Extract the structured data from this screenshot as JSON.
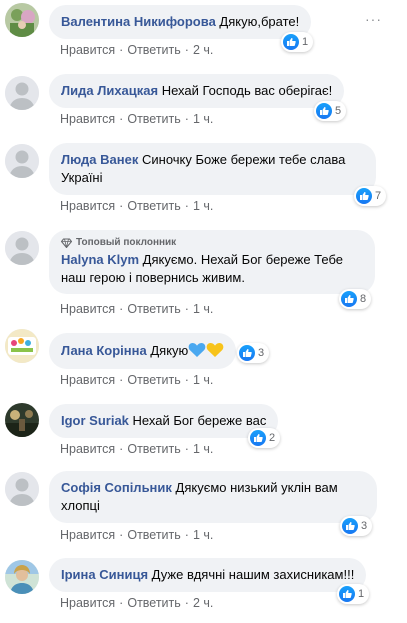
{
  "comments": [
    {
      "author": "Валентина Никифорова",
      "text": "Дякую,брате!",
      "actions": [
        "Нравится",
        "Ответить",
        "2 ч."
      ],
      "likes": "1"
    },
    {
      "author": "Лида Лихацкая",
      "text": "Нехай Господь вас оберігає!",
      "actions": [
        "Нравится",
        "Ответить",
        "1 ч."
      ],
      "likes": "5"
    },
    {
      "author": "Люда Ванек",
      "text_line1": "Синочку Боже бережи тебе слава",
      "text_line2": "Україні",
      "actions": [
        "Нравится",
        "Ответить",
        "1 ч."
      ],
      "likes": "7"
    },
    {
      "badge": "Топовый поклонник",
      "author": "Halyna Klym",
      "text_line1": "Дякуємо. Нехай Бог береже Тебе",
      "text_line2": "наш герою і повернись живим.",
      "actions": [
        "Нравится",
        "Ответить",
        "1 ч."
      ],
      "likes": "8"
    },
    {
      "author": "Лана Корінна",
      "text": "Дякую",
      "actions": [
        "Нравится",
        "Ответить",
        "1 ч."
      ],
      "likes": "3"
    },
    {
      "author": "Igor Suriak",
      "text": "Нехай Бог береже вас",
      "actions": [
        "Нравится",
        "Ответить",
        "1 ч."
      ],
      "likes": "2"
    },
    {
      "author": "Софія Сопільник",
      "text_line1": "Дякуємо низький уклін вам",
      "text_line2": "хлопці",
      "actions": [
        "Нравится",
        "Ответить",
        "1 ч."
      ],
      "likes": "3"
    },
    {
      "author": "Ірина Синиця",
      "text": "Дуже вдячні нашим захисникам!!!",
      "actions": [
        "Нравится",
        "Ответить",
        "2 ч."
      ],
      "likes": "1"
    }
  ],
  "menu_dots": "···",
  "colors": {
    "author": "#385898",
    "bubble": "#f0f2f5",
    "meta": "#65676b",
    "like_blue": "#1877f2"
  }
}
